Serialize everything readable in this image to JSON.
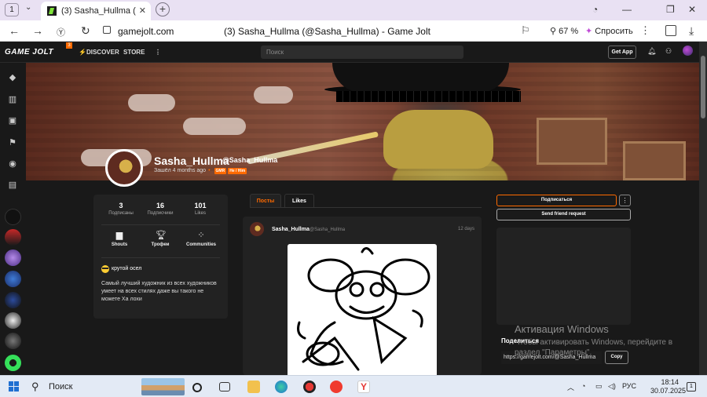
{
  "browser": {
    "tab_count": "1",
    "tab_title": "(3) Sasha_Hullma (@Sa",
    "url": "gamejolt.com",
    "page_title": "(3) Sasha_Hullma (@Sasha_Hullma) - Game Jolt",
    "zoom": "67 %",
    "ask_label": "Спросить"
  },
  "gj": {
    "logo": "GAME JOLT",
    "notif_count": "3",
    "nav_discover": "DISCOVER",
    "nav_store": "STORE",
    "search_placeholder": "Поиск",
    "get_app": "Get App"
  },
  "profile": {
    "name": "Sasha_Hullma",
    "handle": "@Sasha_Hullma",
    "joined": "Зашёл 4 months ago",
    "tags": [
      "GMR",
      "He / Him"
    ],
    "stats": [
      {
        "n": "3",
        "label": "Подписаны"
      },
      {
        "n": "16",
        "label": "Подписчики"
      },
      {
        "n": "101",
        "label": "Likes"
      }
    ],
    "links": [
      {
        "label": "Shouts",
        "icon": "chat-icon"
      },
      {
        "label": "Трофеи",
        "icon": "trophy-icon"
      },
      {
        "label": "Communities",
        "icon": "communities-icon"
      }
    ],
    "bio_title": "крутой осел",
    "bio_text": "Самый лучший художник из всех художников умеет на всех стилях даже вы такого не можете Ха лохи"
  },
  "tabs": [
    {
      "label": "Посты",
      "active": true
    },
    {
      "label": "Likes",
      "active": false
    }
  ],
  "post": {
    "author": "Sasha_Hullma",
    "handle": "@Sasha_Hullma",
    "time": "12 days"
  },
  "actions": {
    "subscribe": "Подписаться",
    "friend_request": "Send friend request",
    "share_label": "Поделиться",
    "share_url": "https://gamejolt.com/@Sasha_Hullma",
    "copy": "Copy"
  },
  "watermark": {
    "line1": "Активация Windows",
    "line2": "Чтобы активировать Windows, перейдите в раздел \"Параметры\"."
  },
  "taskbar": {
    "search": "Поиск",
    "lang": "РУС",
    "time": "18:14",
    "date": "30.07.2025",
    "notif": "1"
  },
  "colors": {
    "accent": "#ff6a00",
    "bg": "#191919",
    "card": "#222222"
  }
}
